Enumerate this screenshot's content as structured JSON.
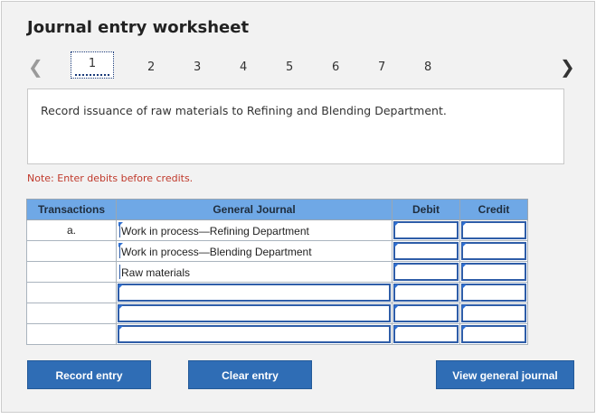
{
  "title": "Journal entry worksheet",
  "pager": {
    "pages": [
      "1",
      "2",
      "3",
      "4",
      "5",
      "6",
      "7",
      "8"
    ],
    "active": "1",
    "prev_icon": "chevron-left-icon",
    "next_icon": "chevron-right-icon"
  },
  "description": "Record issuance of raw materials to Refining and Blending Department.",
  "note": "Note: Enter debits before credits.",
  "table": {
    "headers": {
      "transactions": "Transactions",
      "general_journal": "General Journal",
      "debit": "Debit",
      "credit": "Credit"
    },
    "rows": [
      {
        "transaction": "a.",
        "account": "Work in process—Refining Department",
        "debit": "",
        "credit": ""
      },
      {
        "transaction": "",
        "account": "Work in process—Blending Department",
        "debit": "",
        "credit": ""
      },
      {
        "transaction": "",
        "account": "Raw materials",
        "debit": "",
        "credit": ""
      },
      {
        "transaction": "",
        "account": "",
        "debit": "",
        "credit": ""
      },
      {
        "transaction": "",
        "account": "",
        "debit": "",
        "credit": ""
      },
      {
        "transaction": "",
        "account": "",
        "debit": "",
        "credit": ""
      }
    ]
  },
  "buttons": {
    "record": "Record entry",
    "clear": "Clear entry",
    "view": "View general journal"
  },
  "colors": {
    "header": "#6fa8e6",
    "button": "#2f6db5",
    "note": "#c0392b"
  }
}
